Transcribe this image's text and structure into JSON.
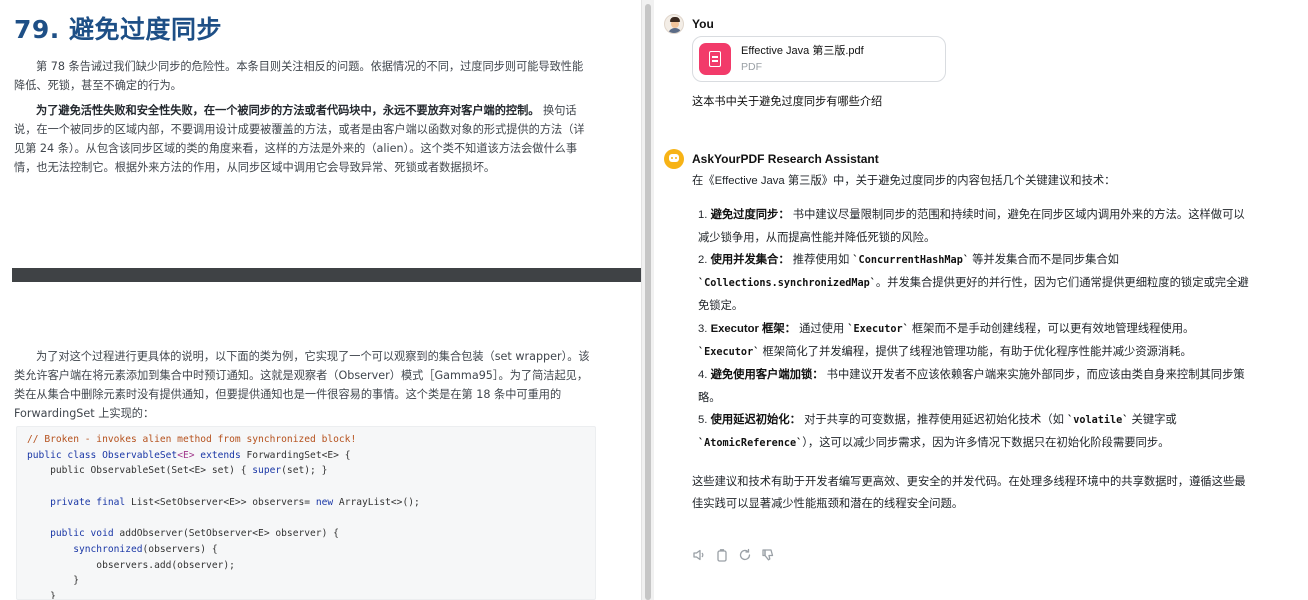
{
  "pdf": {
    "title": "79. 避免过度同步",
    "para1": "第 78 条告诫过我们缺少同步的危险性。本条目则关注相反的问题。依据情况的不同，过度同步则可能导致性能降低、死锁，甚至不确定的行为。",
    "para2_bold": "为了避免活性失败和安全性失败，在一个被同步的方法或者代码块中，永远不要放弃对客户端的控制。",
    "para2_rest": " 换句话说，在一个被同步的区域内部，不要调用设计成要被覆盖的方法，或者是由客户端以函数对象的形式提供的方法（详见第 24 条）。从包含该同步区域的类的角度来看，这样的方法是外来的（alien）。这个类不知道该方法会做什么事情，也无法控制它。根据外来方法的作用，从同步区域中调用它会导致异常、死锁或者数据损坏。",
    "para3": "为了对这个过程进行更具体的说明，以下面的类为例，它实现了一个可以观察到的集合包装（set wrapper）。该类允许客户端在将元素添加到集合中时预订通知。这就是观察者（Observer）模式［Gamma95］。为了简洁起见，类在从集合中删除元素时没有提供通知，但要提供通知也是一件很容易的事情。这个类是在第 18 条中可重用的 ForwardingSet 上实现的：",
    "code": {
      "l1": "// Broken - invokes alien method from synchronized block!",
      "l2a": "public class ",
      "l2b": "ObservableSet",
      "l2c": "<E> ",
      "l2d": "extends ",
      "l2e": "ForwardingSet<E> {",
      "l3a": "    public ObservableSet(Set<E> set) { ",
      "l3b": "super",
      "l3c": "(set); }",
      "l5a": "    private final ",
      "l5b": "List<SetObserver<E>> observers= ",
      "l5c": "new ",
      "l5d": "ArrayList<>();",
      "l7a": "    public void ",
      "l7b": "addObserver(SetObserver<E> observer) {",
      "l8a": "        synchronized",
      "l8b": "(observers) {",
      "l9": "            observers.add(observer);",
      "l10": "        }",
      "l11": "    }"
    }
  },
  "chat": {
    "user": {
      "name": "You",
      "file_name": "Effective Java 第三版.pdf",
      "file_type": "PDF",
      "message": "这本书中关于避免过度同步有哪些介绍"
    },
    "assistant": {
      "name": "AskYourPDF Research Assistant",
      "intro": "在《Effective Java 第三版》中，关于避免过度同步的内容包括几个关键建议和技术：",
      "items": [
        {
          "num": "1. ",
          "title": "避免过度同步：",
          "t1": " 书中建议尽量限制同步的范围和持续时间，避免在同步区域内调用外来的方法。这样做可以减少锁争用，从而提高性能并降低死锁的风险。"
        },
        {
          "num": "2. ",
          "title": "使用并发集合：",
          "t1": " 推荐使用如 ",
          "c1": "`ConcurrentHashMap`",
          "t2": " 等并发集合而不是同步集合如 ",
          "c2": "`Collections.synchronizedMap`",
          "t3": "。并发集合提供更好的并行性，因为它们通常提供更细粒度的锁定或完全避免锁定。"
        },
        {
          "num": "3. ",
          "title": "Executor 框架：",
          "t1": " 通过使用 ",
          "c1": "`Executor`",
          "t2": " 框架而不是手动创建线程，可以更有效地管理线程使用。",
          "c2": "`Executor`",
          "t3": " 框架简化了并发编程，提供了线程池管理功能，有助于优化程序性能并减少资源消耗。"
        },
        {
          "num": "4. ",
          "title": "避免使用客户端加锁：",
          "t1": " 书中建议开发者不应该依赖客户端来实施外部同步，而应该由类自身来控制其同步策略。"
        },
        {
          "num": "5. ",
          "title": "使用延迟初始化：",
          "t1": " 对于共享的可变数据，推荐使用延迟初始化技术（如 ",
          "c1": "`volatile`",
          "t2": " 关键字或 ",
          "c2": "`AtomicReference`",
          "t3": "），这可以减少同步需求，因为许多情况下数据只在初始化阶段需要同步。"
        }
      ],
      "outro": "这些建议和技术有助于开发者编写更高效、更安全的并发代码。在处理多线程环境中的共享数据时，遵循这些最佳实践可以显著减少性能瓶颈和潜在的线程安全问题。"
    },
    "actions": [
      "speaker-icon",
      "copy-icon",
      "regenerate-icon",
      "thumbs-down-icon"
    ]
  }
}
